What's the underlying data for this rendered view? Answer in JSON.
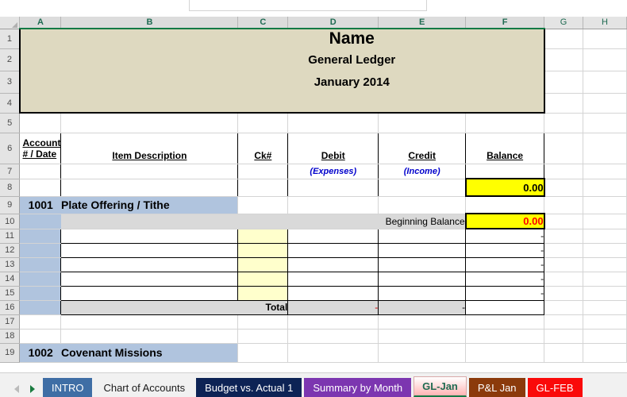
{
  "app": {
    "type": "spreadsheet",
    "column_headers": [
      "A",
      "B",
      "C",
      "D",
      "E",
      "F",
      "G",
      "H"
    ],
    "selected_columns": [
      "A",
      "B",
      "C",
      "D",
      "E",
      "F"
    ],
    "row_numbers": [
      "1",
      "2",
      "3",
      "4",
      "5",
      "6",
      "7",
      "8",
      "9",
      "10",
      "11",
      "12",
      "13",
      "14",
      "15",
      "16",
      "17",
      "18",
      "19"
    ]
  },
  "title_block": {
    "line1": "Name",
    "line2": "General Ledger",
    "line3": "January 2014",
    "fill_color": "#ded9c0"
  },
  "headers": {
    "account_line1": "Account",
    "account_line2": "# / Date",
    "item_description": "Item Description",
    "ck": "Ck#",
    "debit": "Debit",
    "credit": "Credit",
    "balance": "Balance",
    "debit_sub": "(Expenses)",
    "credit_sub": "(Income)",
    "sub_color": "#0000cc"
  },
  "summary": {
    "opening_balance": "0.00",
    "opening_balance_fill": "#ffff00"
  },
  "accounts": [
    {
      "number": "1001",
      "name": "Plate Offering / Tithe",
      "beginning_label": "Beginning Balance",
      "beginning_balance": "0.00",
      "beginning_balance_color": "#ff0000",
      "header_fill": "#b0c4de",
      "rows": [
        {
          "ck": "",
          "debit": "",
          "credit": "",
          "balance": "-"
        },
        {
          "ck": "",
          "debit": "",
          "credit": "",
          "balance": "-"
        },
        {
          "ck": "",
          "debit": "",
          "credit": "",
          "balance": "-"
        },
        {
          "ck": "",
          "debit": "",
          "credit": "",
          "balance": "-"
        },
        {
          "ck": "",
          "debit": "",
          "credit": "",
          "balance": "-"
        }
      ],
      "total_label": "Total",
      "total_debit": "-",
      "total_credit": "-",
      "total_balance": ""
    },
    {
      "number": "1002",
      "name": "Covenant Missions",
      "header_fill": "#b0c4de"
    }
  ],
  "tabs": [
    {
      "label": "INTRO",
      "bg": "#3f6ea5",
      "fg": "#ffffff",
      "active": false
    },
    {
      "label": "Chart of Accounts",
      "bg": "#f1f1f1",
      "fg": "#1a1a1a",
      "active": false
    },
    {
      "label": "Budget vs. Actual 1",
      "bg": "#0d2355",
      "fg": "#ffffff",
      "active": false
    },
    {
      "label": "Summary by Month",
      "bg": "#7c36b0",
      "fg": "#ffffff",
      "active": false
    },
    {
      "label": "GL-Jan",
      "bg": "#ffc5c5",
      "fg": "#1f6b52",
      "active": true
    },
    {
      "label": "P&L Jan",
      "bg": "#8b3a0b",
      "fg": "#ffffff",
      "active": false
    },
    {
      "label": "GL-FEB",
      "bg": "#fa0a0a",
      "fg": "#ffffff",
      "active": false
    }
  ],
  "nav": {
    "prev_icon": "triangle-left-icon",
    "next_icon": "triangle-right-icon"
  }
}
